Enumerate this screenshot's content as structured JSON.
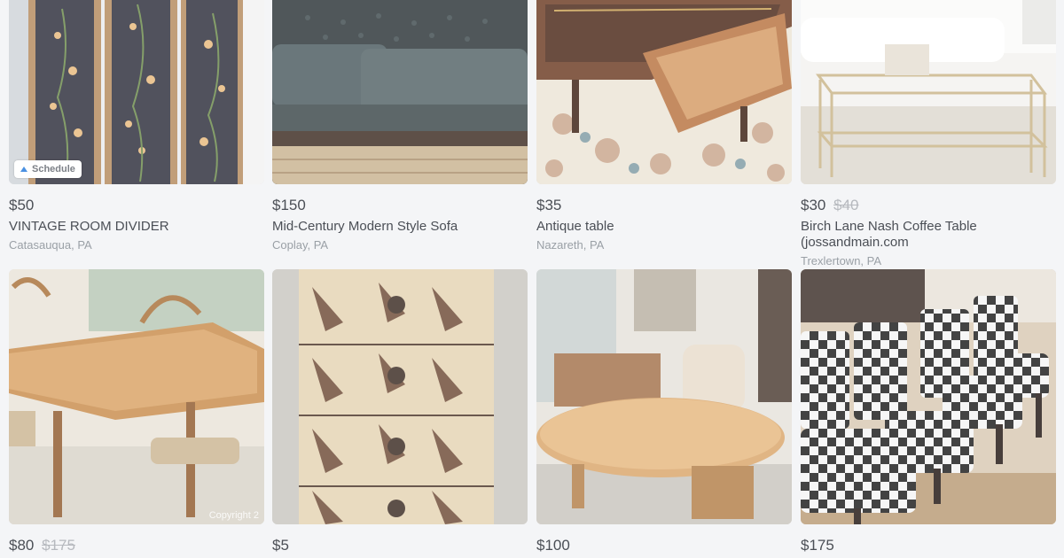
{
  "colors": {
    "price": "#4b4f56",
    "strike": "#b6b9be",
    "location": "#9aa0a6",
    "background": "#f4f5f7"
  },
  "listings": [
    {
      "price": "$50",
      "old_price": "",
      "title": "VINTAGE ROOM DIVIDER",
      "location": "Catasauqua, PA",
      "badge": "Schedule",
      "badge_icon": "schedule-icon"
    },
    {
      "price": "$150",
      "old_price": "",
      "title": "Mid-Century Modern Style Sofa",
      "location": "Coplay, PA"
    },
    {
      "price": "$35",
      "old_price": "",
      "title": "Antique table",
      "location": "Nazareth, PA"
    },
    {
      "price": "$30",
      "old_price": "$40",
      "title": "Birch Lane Nash Coffee Table (jossandmain.com",
      "location": "Trexlertown, PA"
    },
    {
      "price": "$80",
      "old_price": "$175",
      "title": "",
      "location": "",
      "watermark": "Copyright 2"
    },
    {
      "price": "$5",
      "old_price": "",
      "title": "",
      "location": ""
    },
    {
      "price": "$100",
      "old_price": "",
      "title": "",
      "location": ""
    },
    {
      "price": "$175",
      "old_price": "",
      "title": "",
      "location": ""
    }
  ]
}
